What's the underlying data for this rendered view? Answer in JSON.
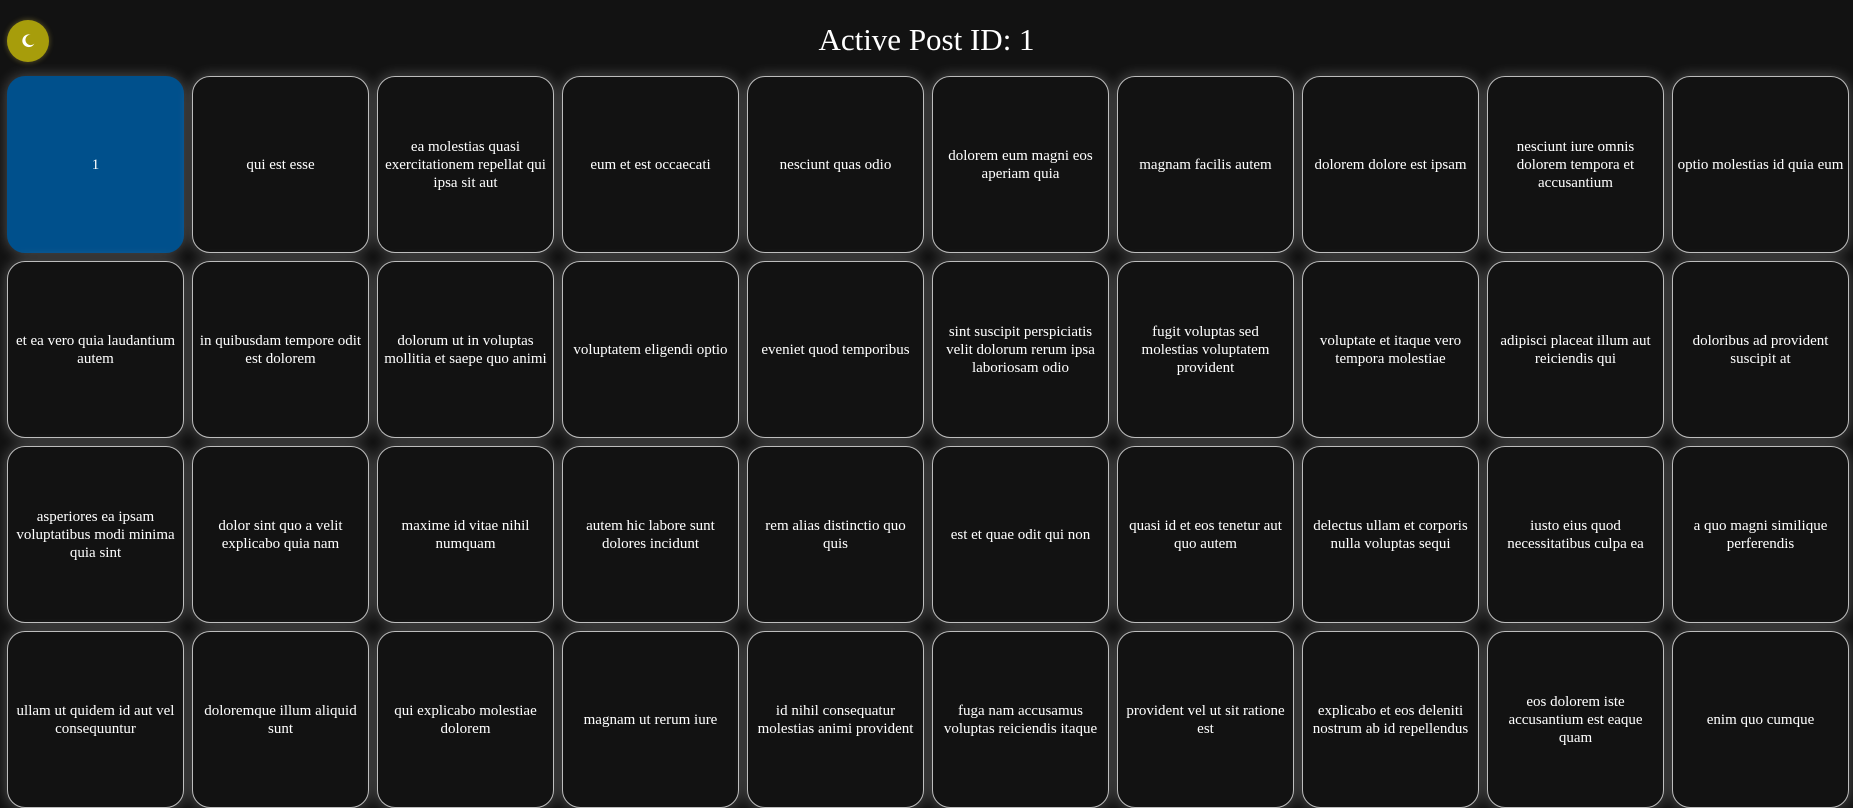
{
  "header": {
    "title": "Active Post ID: 1",
    "theme_toggle_icon": "moon-icon",
    "theme_toggle_color": "#a79d0b"
  },
  "colors": {
    "background": "#121212",
    "active_card": "#00508c",
    "card_border": "#bdbdbd"
  },
  "posts": [
    {
      "label": "1",
      "active": true
    },
    {
      "label": "qui est esse"
    },
    {
      "label": "ea molestias quasi exercitationem repellat qui ipsa sit aut"
    },
    {
      "label": "eum et est occaecati"
    },
    {
      "label": "nesciunt quas odio"
    },
    {
      "label": "dolorem eum magni eos aperiam quia"
    },
    {
      "label": "magnam facilis autem"
    },
    {
      "label": "dolorem dolore est ipsam"
    },
    {
      "label": "nesciunt iure omnis dolorem tempora et accusantium"
    },
    {
      "label": "optio molestias id quia eum"
    },
    {
      "label": "et ea vero quia laudantium autem"
    },
    {
      "label": "in quibusdam tempore odit est dolorem"
    },
    {
      "label": "dolorum ut in voluptas mollitia et saepe quo animi"
    },
    {
      "label": "voluptatem eligendi optio"
    },
    {
      "label": "eveniet quod temporibus"
    },
    {
      "label": "sint suscipit perspiciatis velit dolorum rerum ipsa laboriosam odio"
    },
    {
      "label": "fugit voluptas sed molestias voluptatem provident"
    },
    {
      "label": "voluptate et itaque vero tempora molestiae"
    },
    {
      "label": "adipisci placeat illum aut reiciendis qui"
    },
    {
      "label": "doloribus ad provident suscipit at"
    },
    {
      "label": "asperiores ea ipsam voluptatibus modi minima quia sint"
    },
    {
      "label": "dolor sint quo a velit explicabo quia nam"
    },
    {
      "label": "maxime id vitae nihil numquam"
    },
    {
      "label": "autem hic labore sunt dolores incidunt"
    },
    {
      "label": "rem alias distinctio quo quis"
    },
    {
      "label": "est et quae odit qui non"
    },
    {
      "label": "quasi id et eos tenetur aut quo autem"
    },
    {
      "label": "delectus ullam et corporis nulla voluptas sequi"
    },
    {
      "label": "iusto eius quod necessitatibus culpa ea"
    },
    {
      "label": "a quo magni similique perferendis"
    },
    {
      "label": "ullam ut quidem id aut vel consequuntur"
    },
    {
      "label": "doloremque illum aliquid sunt"
    },
    {
      "label": "qui explicabo molestiae dolorem"
    },
    {
      "label": "magnam ut rerum iure"
    },
    {
      "label": "id nihil consequatur molestias animi provident"
    },
    {
      "label": "fuga nam accusamus voluptas reiciendis itaque"
    },
    {
      "label": "provident vel ut sit ratione est"
    },
    {
      "label": "explicabo et eos deleniti nostrum ab id repellendus"
    },
    {
      "label": "eos dolorem iste accusantium est eaque quam"
    },
    {
      "label": "enim quo cumque"
    }
  ]
}
